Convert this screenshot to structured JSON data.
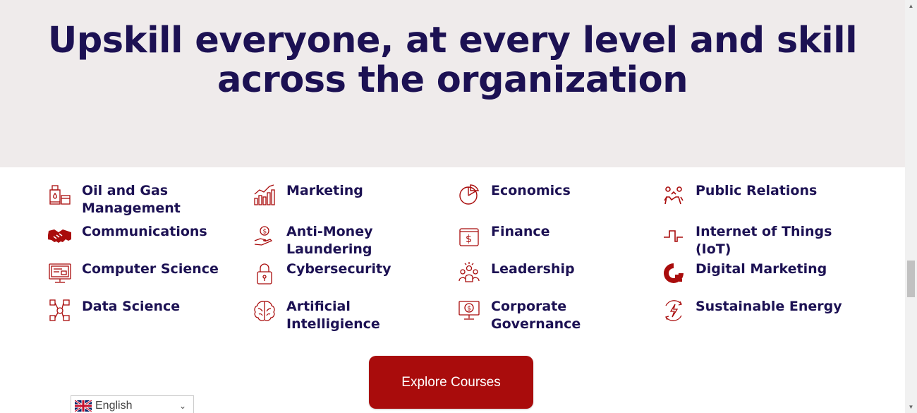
{
  "hero": {
    "title_line1": "Upskill everyone, at every level and skill",
    "title_line2": "across the organization"
  },
  "topics": {
    "col1": [
      {
        "label": "Oil and Gas Management",
        "icon": "oil-gas-icon"
      },
      {
        "label": "Communications",
        "icon": "handshake-icon"
      },
      {
        "label": "Computer Science",
        "icon": "computer-icon"
      },
      {
        "label": "Data Science",
        "icon": "data-network-icon"
      }
    ],
    "col2": [
      {
        "label": "Marketing",
        "icon": "bar-chart-icon"
      },
      {
        "label": "Anti-Money Laundering",
        "icon": "money-hand-icon"
      },
      {
        "label": "Cybersecurity",
        "icon": "padlock-icon"
      },
      {
        "label": "Artificial Intelligience",
        "icon": "brain-icon"
      }
    ],
    "col3": [
      {
        "label": "Economics",
        "icon": "pie-chart-icon"
      },
      {
        "label": "Finance",
        "icon": "dollar-bill-icon"
      },
      {
        "label": "Leadership",
        "icon": "team-icon"
      },
      {
        "label": "Corporate Governance",
        "icon": "monitor-dollar-icon"
      }
    ],
    "col4": [
      {
        "label": "Public Relations",
        "icon": "people-icon"
      },
      {
        "label": "Internet of Things (IoT)",
        "icon": "signal-icon"
      },
      {
        "label": "Digital Marketing",
        "icon": "digital-logo-icon"
      },
      {
        "label": "Sustainable Energy",
        "icon": "energy-icon"
      }
    ]
  },
  "cta": {
    "label": "Explore Courses"
  },
  "language": {
    "selected": "English"
  },
  "colors": {
    "accent": "#a90c0c",
    "heading": "#1c1153",
    "hero_bg": "#efebeb"
  }
}
